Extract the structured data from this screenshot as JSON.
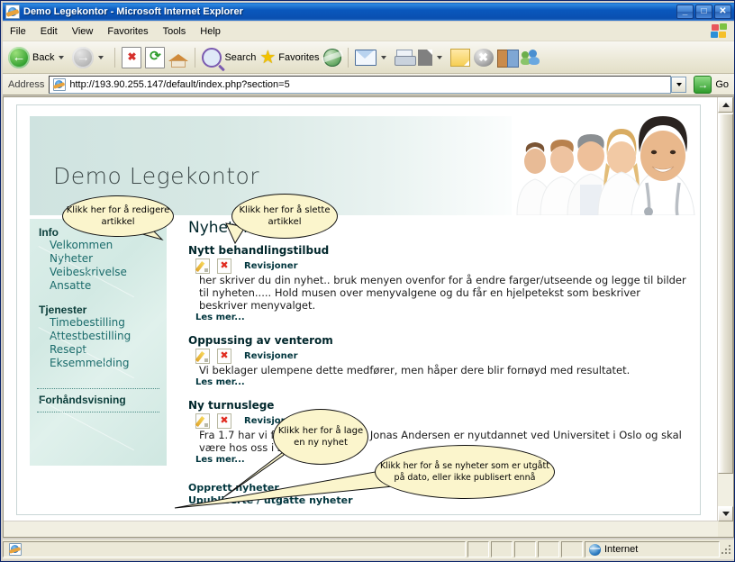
{
  "window": {
    "title": "Demo Legekontor - Microsoft Internet Explorer",
    "minimize": "_",
    "maximize": "□",
    "close": "✕"
  },
  "menu": {
    "items": [
      "File",
      "Edit",
      "View",
      "Favorites",
      "Tools",
      "Help"
    ]
  },
  "toolbar": {
    "back": "Back",
    "search": "Search",
    "favorites": "Favorites",
    "icons": [
      "back-icon",
      "forward-icon",
      "stop-icon",
      "refresh-icon",
      "home-icon",
      "search-icon",
      "favorites-star-icon",
      "history-icon",
      "mail-icon",
      "print-icon",
      "edit-page-icon",
      "discuss-icon",
      "messenger-block-icon",
      "research-icon",
      "messenger-icon"
    ]
  },
  "address": {
    "label": "Address",
    "url": "http://193.90.255.147/default/index.php?section=5",
    "go": "Go"
  },
  "site": {
    "title": "Demo Legekontor",
    "sidebar": {
      "groups": [
        {
          "heading": "Info",
          "links": [
            "Velkommen",
            "Nyheter",
            "Veibeskrivelse",
            "Ansatte"
          ]
        },
        {
          "heading": "Tjenester",
          "links": [
            "Timebestilling",
            "Attestbestilling",
            "Resept",
            "Eksemmelding"
          ]
        }
      ],
      "preview": "Forhåndsvisning"
    },
    "content": {
      "heading": "Nyheter",
      "news": [
        {
          "title": "Nytt behandlingstilbud",
          "revisions": "Revisjoner",
          "body": "her skriver du din nyhet.. bruk menyen ovenfor for å endre farger/utseende og legge til bilder til nyheten..... Hold musen over menyvalgene og du får en hjelpetekst som beskriver beskriver menyvalget.",
          "more": "Les mer..."
        },
        {
          "title": "Oppussing av venterom",
          "revisions": "Revisjoner",
          "body": "Vi beklager ulempene dette medfører, men håper dere blir fornøyd med resultatet.",
          "more": "Les mer..."
        },
        {
          "title": "Ny turnuslege",
          "revisions": "Revisjoner",
          "body": "Fra 1.7 har vi fått ny turnuslege. Jonas Andersen er nyutdannet ved Universitet i Oslo og skal være hos oss i seks måneder.",
          "more": "Les mer..."
        }
      ],
      "bottom_links": [
        "Opprett nyheter",
        "Upubliserte / utgåtte nyheter"
      ]
    }
  },
  "callouts": [
    {
      "text": "Klikk her for å redigere artikkel"
    },
    {
      "text": "Klikk her for å slette artikkel"
    },
    {
      "text": "Klikk her for å lage en ny nyhet"
    },
    {
      "text": "Klikk her for å se nyheter som er utgått på dato, eller ikke publisert ennå"
    }
  ],
  "status": {
    "zone": "Internet"
  },
  "colors": {
    "titlebar": "#0a58bd",
    "chrome": "#ece9d8",
    "site_accent": "#d2e9e3",
    "link": "#1a6b6b",
    "heading": "#00262b",
    "callout_fill": "#fbf5cc"
  }
}
